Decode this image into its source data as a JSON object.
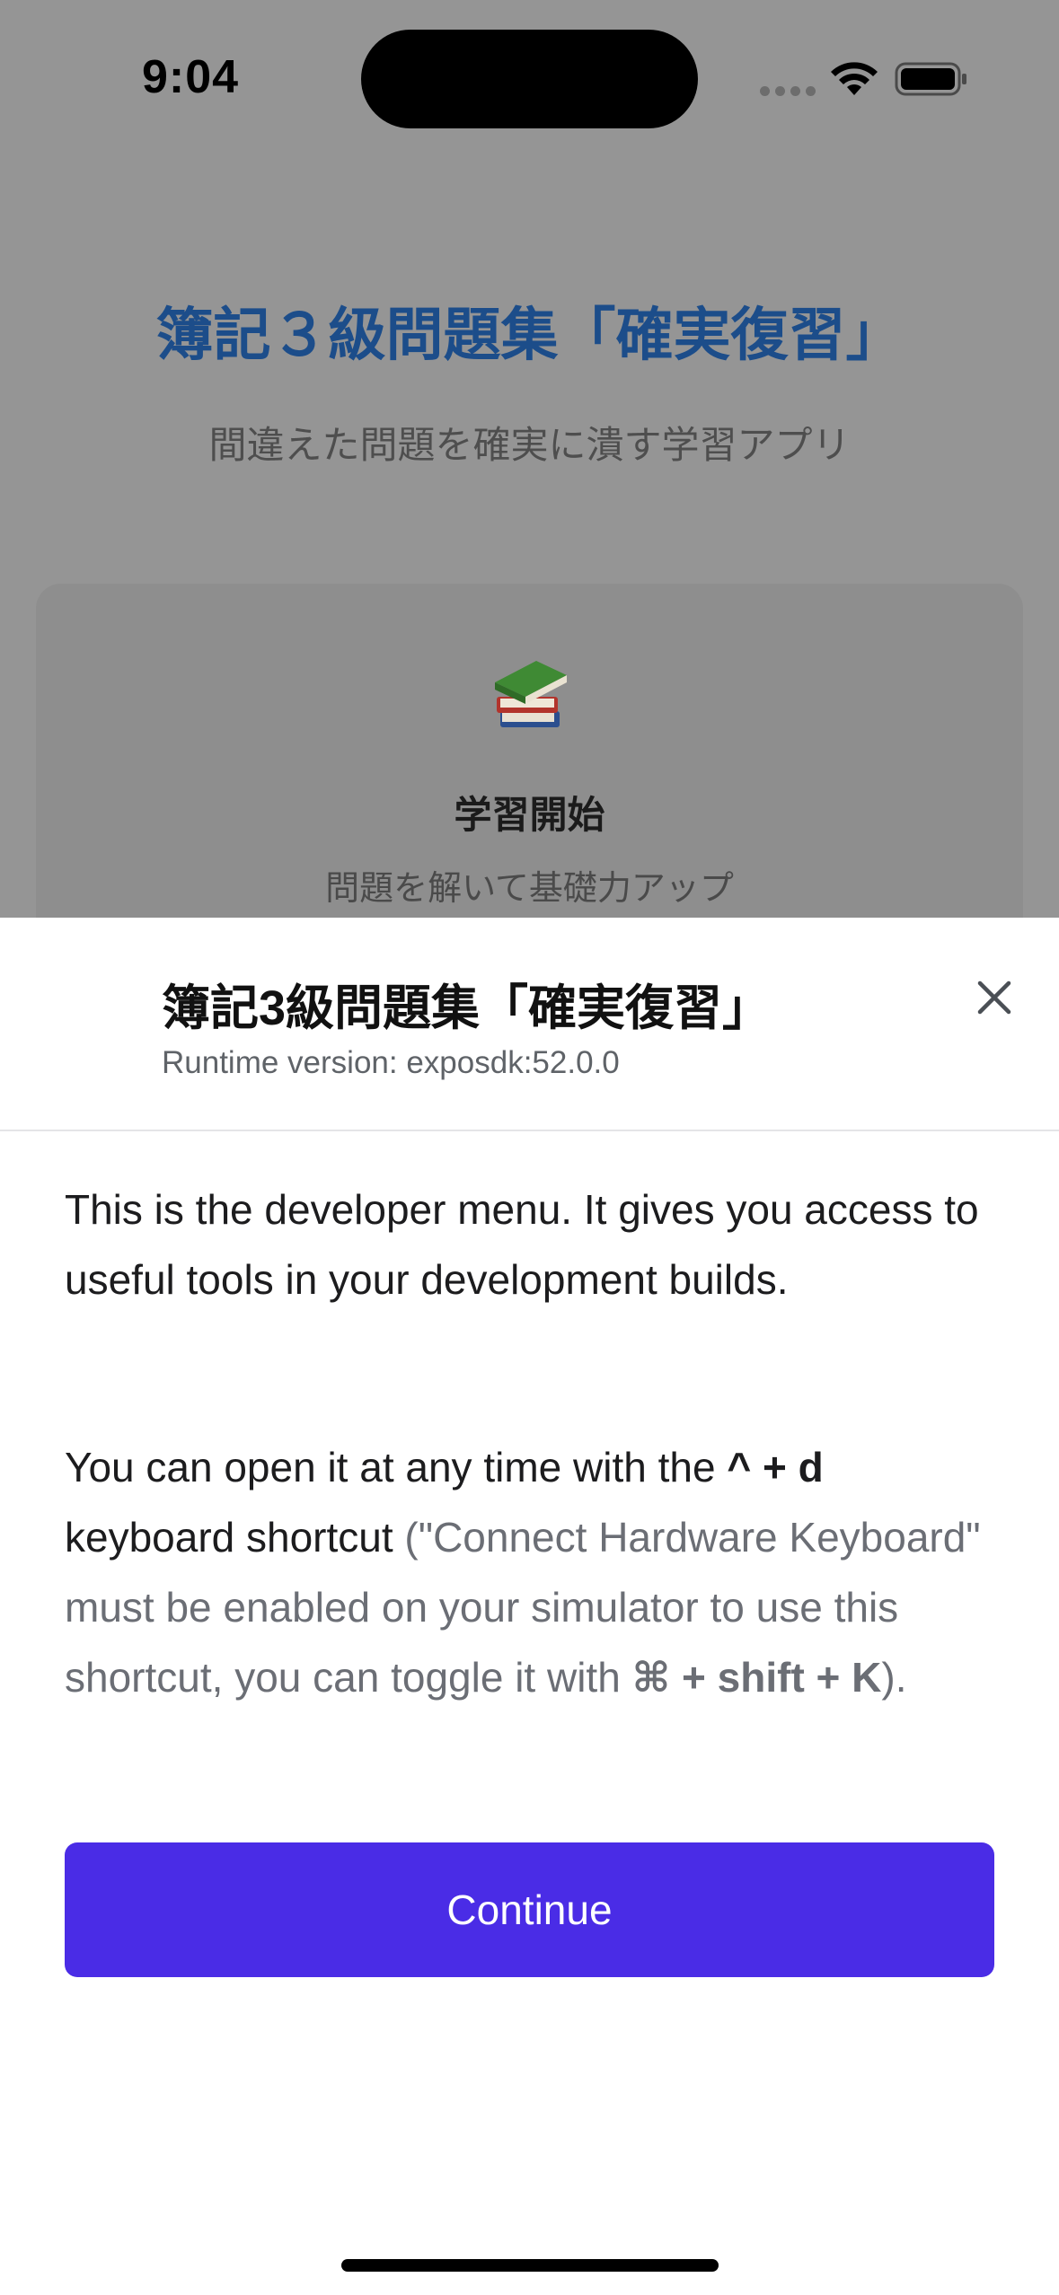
{
  "status_bar": {
    "time": "9:04",
    "icons": [
      "cellular-icon",
      "wifi-icon",
      "battery-icon"
    ]
  },
  "app": {
    "title": "簿記３級問題集「確実復習」",
    "subtitle": "間違えた問題を確実に潰す学習アプリ",
    "start_card": {
      "icon": "books-icon",
      "title": "学習開始",
      "subtitle": "問題を解いて基礎力アップ"
    }
  },
  "dev_menu": {
    "title": "簿記3級問題集「確実復習」",
    "runtime": "Runtime version: exposdk:52.0.0",
    "close_icon": "close-icon",
    "paragraph1": "This is the developer menu. It gives you access to useful tools in your development builds.",
    "paragraph2": {
      "part1": "You can open it at any time with the ",
      "shortcut": "^ + d",
      "part2": " keyboard shortcut",
      "part3": " (\"Connect Hardware Keyboard\" must be enabled on your simulator to use this shortcut, you can toggle it with ",
      "shortcut2": "⌘ + shift + K",
      "part4": ")."
    },
    "continue_label": "Continue"
  },
  "colors": {
    "accent": "#4a2ce6",
    "app_title": "#1c4d8a",
    "overlay": "#959595"
  }
}
